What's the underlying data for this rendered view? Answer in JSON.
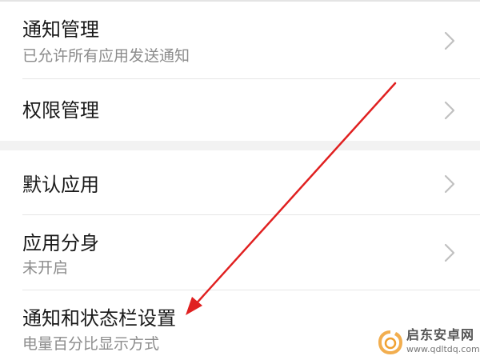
{
  "settings": {
    "group1": [
      {
        "title": "通知管理",
        "subtitle": "已允许所有应用发送通知",
        "icon": "chevron-right-icon"
      },
      {
        "title": "权限管理",
        "icon": "chevron-right-icon"
      }
    ],
    "group2": [
      {
        "title": "默认应用",
        "icon": "chevron-right-icon"
      },
      {
        "title": "应用分身",
        "subtitle": "未开启",
        "icon": "chevron-right-icon"
      },
      {
        "title": "通知和状态栏设置",
        "subtitle": "电量百分比显示方式"
      }
    ]
  },
  "annotation": {
    "arrow_color": "#e02020"
  },
  "watermark": {
    "name": "启东安卓网",
    "url": "www.qdltdq.com",
    "logo_color": "#f0a030"
  },
  "colors": {
    "title_text": "#1a1a1a",
    "subtitle_text": "#8c8c8c",
    "chevron": "#c0c0c0",
    "divider": "#e6e6e6",
    "group_gap": "#f2f2f2"
  }
}
